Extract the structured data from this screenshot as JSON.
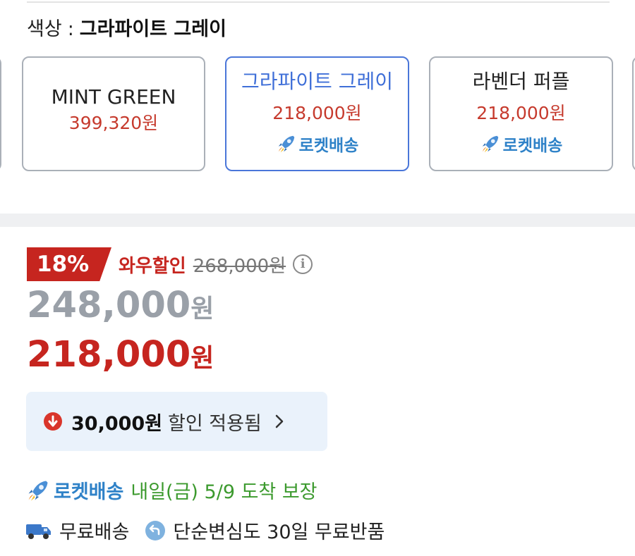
{
  "color_selector": {
    "label": "색상",
    "separator": ":",
    "selected_value": "그라파이트 그레이",
    "options": [
      {
        "name": "MINT GREEN",
        "price": "399,320원",
        "rocket": ""
      },
      {
        "name": "그라파이트 그레이",
        "price": "218,000원",
        "rocket": "로켓배송"
      },
      {
        "name": "라벤더 퍼플",
        "price": "218,000원",
        "rocket": "로켓배송"
      }
    ]
  },
  "pricing": {
    "discount_percent": "18%",
    "wow_label": "와우할인",
    "original_price": "268,000원",
    "price_before_value": "248,000",
    "price_after_value": "218,000",
    "currency_unit": "원"
  },
  "applied_discount": {
    "amount": "30,000원",
    "text": "할인 적용됨"
  },
  "delivery": {
    "rocket_label": "로켓배송",
    "eta": "내일(금) 5/9 도착 보장"
  },
  "shipping": {
    "free_shipping": "무료배송",
    "free_return": "단순변심도 30일 무료반품"
  },
  "colors": {
    "accent_blue": "#3f6fd8",
    "price_red": "#c6251f",
    "rocket_blue": "#2f82c8",
    "eta_green": "#3c9a2e"
  }
}
